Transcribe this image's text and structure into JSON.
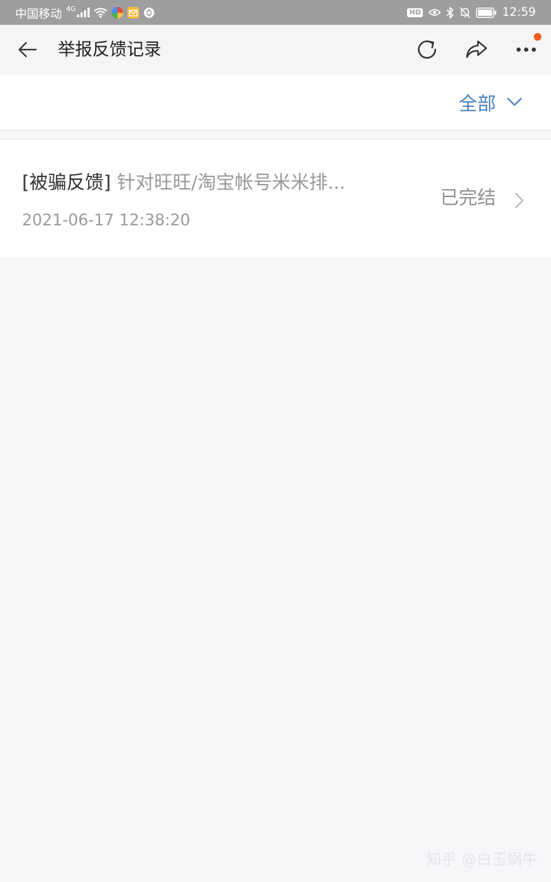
{
  "status_bar": {
    "carrier": "中国移动",
    "network": "4G",
    "time": "12:59",
    "hd_label": "HD",
    "icons": [
      "signal-icon",
      "wifi-icon",
      "app-icon",
      "mail-icon",
      "sync-icon",
      "eye-icon",
      "bluetooth-icon",
      "mute-icon",
      "battery-icon"
    ]
  },
  "navbar": {
    "title": "举报反馈记录",
    "icons": [
      "back-arrow-icon",
      "refresh-icon",
      "share-icon",
      "more-icon"
    ],
    "badge_color": "#f25a1f"
  },
  "filter": {
    "label": "全部",
    "color": "#4a7fc1"
  },
  "records": [
    {
      "category": "[被骗反馈]",
      "title": "针对旺旺/淘宝帐号米米排...",
      "time": "2021-06-17 12:38:20",
      "status": "已完结"
    }
  ],
  "watermark": "知乎 @白玉蜗牛"
}
